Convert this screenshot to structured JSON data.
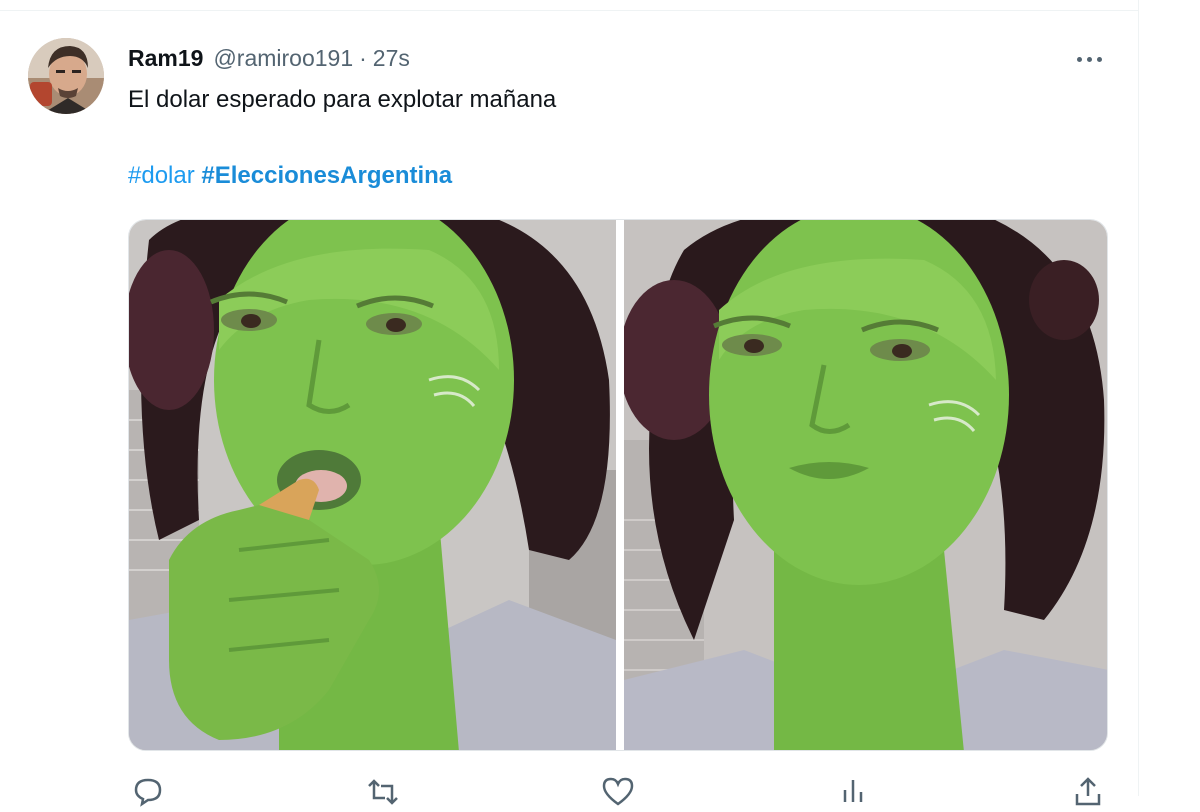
{
  "tweet": {
    "display_name": "Ram19",
    "handle": "@ramiroo191",
    "separator": "·",
    "timestamp": "27s",
    "text": "El dolar esperado para explotar mañana",
    "hashtags": [
      {
        "text": "#dolar",
        "bold": false
      },
      {
        "text": "#EleccionesArgentina",
        "bold": true
      }
    ],
    "media": [
      {
        "icon": "photo-green-woman-applying-lipstick"
      },
      {
        "icon": "photo-green-woman-posing"
      }
    ]
  },
  "actions": [
    {
      "icon": "reply-icon"
    },
    {
      "icon": "retweet-icon"
    },
    {
      "icon": "like-icon"
    },
    {
      "icon": "views-icon"
    },
    {
      "icon": "share-icon"
    }
  ],
  "colors": {
    "text_primary": "#0f1419",
    "text_secondary": "#536471",
    "link": "#1d9bf0",
    "divider": "#eff3f4",
    "skin_green": "#7ec24e"
  }
}
